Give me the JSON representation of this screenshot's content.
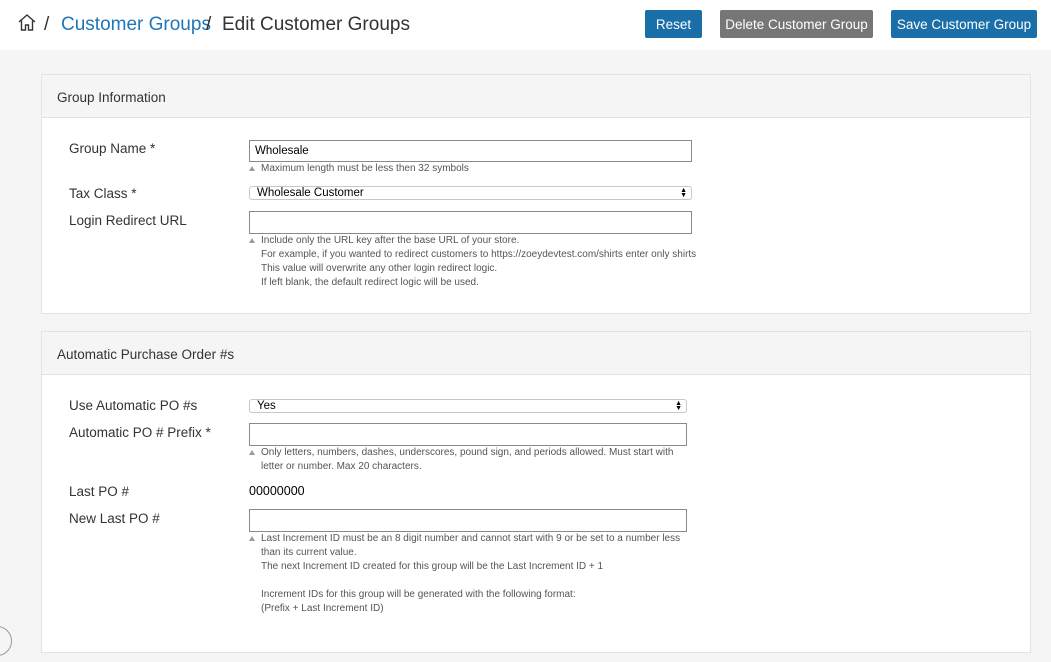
{
  "header": {
    "breadcrumb_sep": "/",
    "crumb_parent": "Customer Groups",
    "crumb_current": "Edit Customer Groups",
    "buttons": {
      "reset": "Reset",
      "delete": "Delete Customer Group",
      "save": "Save Customer Group"
    }
  },
  "group_info": {
    "title": "Group Information",
    "group_name_label": "Group Name *",
    "group_name_value": "Wholesale",
    "group_name_hint": "Maximum length must be less then 32 symbols",
    "tax_class_label": "Tax Class *",
    "tax_class_value": "Wholesale Customer",
    "login_redirect_label": "Login Redirect URL",
    "login_redirect_value": "",
    "login_redirect_hint": [
      "Include only the URL key after the base URL of your store.",
      "For example, if you wanted to redirect customers to https://zoeydevtest.com/shirts enter only shirts",
      "This value will overwrite any other login redirect logic.",
      "If left blank, the default redirect logic will be used."
    ]
  },
  "po": {
    "title": "Automatic Purchase Order #s",
    "use_auto_label": "Use Automatic PO #s",
    "use_auto_value": "Yes",
    "prefix_label": "Automatic PO # Prefix *",
    "prefix_value": "",
    "prefix_hint": [
      "Only letters, numbers, dashes, underscores, pound sign, and periods allowed. Must start with",
      "letter or number. Max 20 characters."
    ],
    "last_po_label": "Last PO #",
    "last_po_value": "00000000",
    "new_last_po_label": "New Last PO #",
    "new_last_po_value": "",
    "new_last_po_hint": [
      "Last Increment ID must be an 8 digit number and cannot start with 9 or be set to a number less",
      "than its current value.",
      "The next Increment ID created for this group will be the Last Increment ID + 1",
      "",
      "Increment IDs for this group will be generated with the following format:",
      "(Prefix + Last Increment ID)"
    ]
  }
}
